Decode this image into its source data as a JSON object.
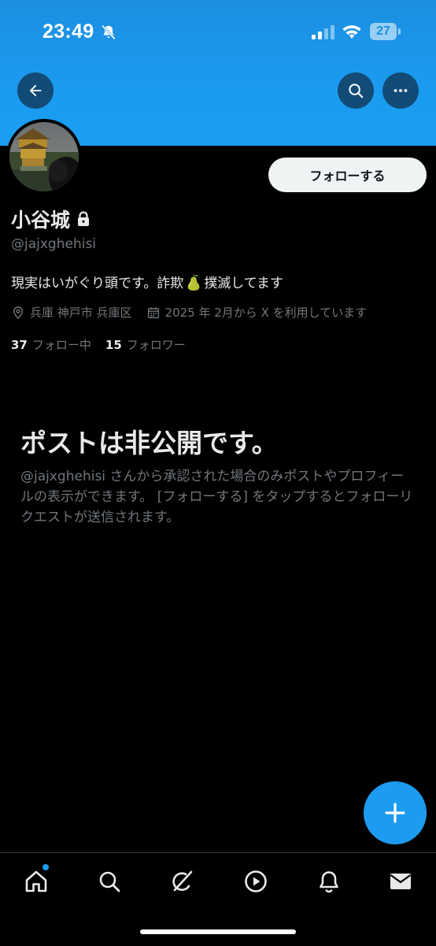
{
  "status_bar": {
    "time": "23:49",
    "battery_level": "27"
  },
  "header": {
    "back_icon": "arrow-left-icon",
    "search_icon": "search-icon",
    "more_icon": "more-horizontal-icon",
    "banner_color": "#1d9bf0"
  },
  "profile": {
    "avatar_icon": "avatar-photo",
    "follow_label": "フォローする",
    "display_name": "小谷城",
    "lock_icon": "lock-icon",
    "handle": "@jajxghehisi",
    "bio_before": "現実はいがぐり頭です。詐欺",
    "bio_emoji": "pear-icon",
    "bio_after": "撲滅してます",
    "location": "兵庫 神戸市 兵庫区",
    "joined": "2025 年 2月から X を利用しています",
    "following_count": "37",
    "following_label": "フォロー中",
    "followers_count": "15",
    "followers_label": "フォロワー"
  },
  "private_notice": {
    "title": "ポストは非公開です。",
    "description": "@jajxghehisi さんから承認された場合のみポストやプロフィールの表示ができます。 [フォローする] をタップするとフォローリクエストが送信されます。"
  },
  "fab": {
    "icon": "plus-icon",
    "color": "#1d9bf0"
  },
  "bottom_nav": {
    "items": [
      "home-icon",
      "search-icon",
      "grok-icon",
      "video-icon",
      "notifications-icon",
      "messages-icon"
    ],
    "home_has_badge": true
  }
}
